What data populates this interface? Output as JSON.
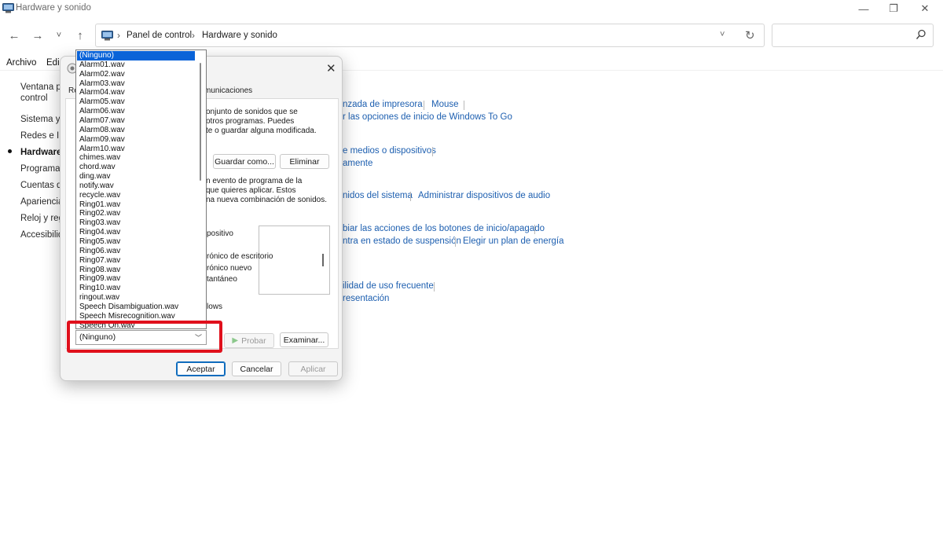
{
  "window": {
    "title": "Hardware y sonido",
    "minimize": "—",
    "maximize": "❐",
    "close": "✕"
  },
  "nav": {
    "back": "←",
    "forward": "→",
    "recent": "˅",
    "up": "↑",
    "breadcrumb": [
      "Panel de control",
      "Hardware y sonido"
    ],
    "separator": "›",
    "dropdown": "˅",
    "refresh": "↻",
    "search_placeholder": ""
  },
  "menu": [
    "Archivo",
    "Edi"
  ],
  "sidebar": {
    "items": [
      {
        "label": "Ventana pr"
      },
      {
        "label": "control"
      },
      {
        "label": "Sistema y s"
      },
      {
        "label": "Redes e Int"
      },
      {
        "label": "Hardware",
        "active": true
      },
      {
        "label": "Programas"
      },
      {
        "label": "Cuentas de"
      },
      {
        "label": "Apariencia"
      },
      {
        "label": "Reloj y regi"
      },
      {
        "label": "Accesibilid"
      }
    ]
  },
  "links": [
    "nzada de impresora",
    "Mouse",
    "r las opciones de inicio de Windows To Go",
    "e medios o dispositivos",
    "amente",
    "nidos del sistema",
    "Administrar dispositivos de audio",
    "biar las acciones de los botones de inicio/apagado",
    "ntra en estado de suspensión",
    "Elegir un plan de energía",
    "ilidad de uso frecuente",
    "resentación"
  ],
  "dialog": {
    "close": "✕",
    "tabs": [
      "Re",
      "municaciones"
    ],
    "text1": [
      "onjunto de sonidos que se",
      "otros programas. Puedes",
      "te o guardar alguna modificada."
    ],
    "save_as": "Guardar como...",
    "delete": "Eliminar",
    "text2": [
      "n evento de programa de la",
      "que quieres aplicar. Estos",
      "na nueva combinación de sonidos."
    ],
    "events": [
      "positivo",
      "rónico de escritorio",
      "rónico nuevo",
      "tantáneo"
    ],
    "windows_label": "lows",
    "test": "Probar",
    "test_icon": "▶",
    "browse": "Examinar...",
    "ok": "Aceptar",
    "cancel": "Cancelar",
    "apply": "Aplicar"
  },
  "sound_combo": {
    "value": "(Ninguno)",
    "chevron": "﹀",
    "options": [
      "(Ninguno)",
      "Alarm01.wav",
      "Alarm02.wav",
      "Alarm03.wav",
      "Alarm04.wav",
      "Alarm05.wav",
      "Alarm06.wav",
      "Alarm07.wav",
      "Alarm08.wav",
      "Alarm09.wav",
      "Alarm10.wav",
      "chimes.wav",
      "chord.wav",
      "ding.wav",
      "notify.wav",
      "recycle.wav",
      "Ring01.wav",
      "Ring02.wav",
      "Ring03.wav",
      "Ring04.wav",
      "Ring05.wav",
      "Ring06.wav",
      "Ring07.wav",
      "Ring08.wav",
      "Ring09.wav",
      "Ring10.wav",
      "ringout.wav",
      "Speech Disambiguation.wav",
      "Speech Misrecognition.wav",
      "Speech On.wav"
    ],
    "selected_index": 0
  },
  "colors": {
    "link": "#1d5fb0",
    "selection": "#0a63d8",
    "highlight_box": "#e0101c"
  }
}
